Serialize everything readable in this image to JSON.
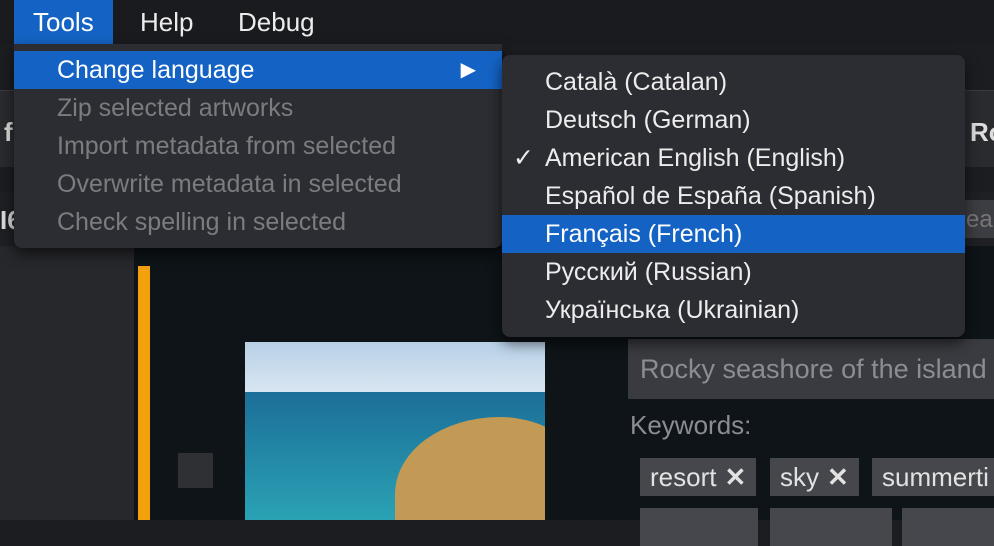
{
  "menubar": {
    "items": [
      {
        "label": "Tools"
      },
      {
        "label": "Help"
      },
      {
        "label": "Debug"
      }
    ]
  },
  "tools_menu": {
    "items": [
      {
        "label": "Change language",
        "enabled": true,
        "highlighted": true,
        "submenu_arrow": "▶"
      },
      {
        "label": "Zip selected artworks",
        "enabled": false
      },
      {
        "label": "Import metadata from selected",
        "enabled": false
      },
      {
        "label": "Overwrite metadata in selected",
        "enabled": false
      },
      {
        "label": "Check spelling in selected",
        "enabled": false
      }
    ]
  },
  "language_menu": {
    "check_mark": "✓",
    "items": [
      {
        "label": "Català (Catalan)"
      },
      {
        "label": "Deutsch (German)"
      },
      {
        "label": "American English (English)",
        "checked": true
      },
      {
        "label": "Español de España (Spanish)"
      },
      {
        "label": "Français (French)",
        "highlighted": true
      },
      {
        "label": "Русский (Russian)"
      },
      {
        "label": "Українська (Ukrainian)"
      }
    ]
  },
  "background": {
    "toolbar_left": "f",
    "toolbar_right": "Ro",
    "row2_left": "I6",
    "row2_right": "ea",
    "description": "Rocky seashore of the island",
    "keywords_label": "Keywords:",
    "keywords": [
      {
        "label": "resort",
        "remove": "✕"
      },
      {
        "label": "sky",
        "remove": "✕"
      },
      {
        "label": "summerti",
        "remove": ""
      }
    ]
  },
  "colors": {
    "accent": "#1463c4",
    "marker": "#f2a10c"
  }
}
